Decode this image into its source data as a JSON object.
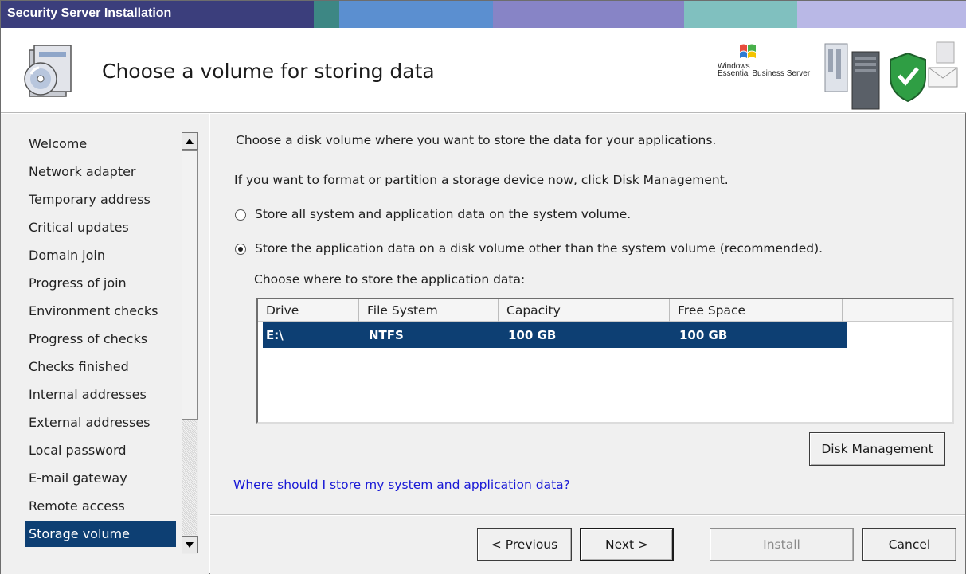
{
  "window": {
    "title": "Security Server Installation",
    "title_colors": [
      "#3a3d7a",
      "#4a5aa0",
      "#3e8a88",
      "#5a8fd0",
      "#8a86c7",
      "#7fbfbf",
      "#b9b9e6"
    ]
  },
  "header": {
    "title": "Choose a volume for storing data",
    "brand_line1": "Windows",
    "brand_line2": "Essential Business Server"
  },
  "sidebar": {
    "items": [
      {
        "label": "Welcome"
      },
      {
        "label": "Network adapter"
      },
      {
        "label": "Temporary address"
      },
      {
        "label": "Critical updates"
      },
      {
        "label": "Domain join"
      },
      {
        "label": "Progress of join"
      },
      {
        "label": "Environment checks"
      },
      {
        "label": "Progress of checks"
      },
      {
        "label": "Checks finished"
      },
      {
        "label": "Internal addresses"
      },
      {
        "label": "External addresses"
      },
      {
        "label": "Local password"
      },
      {
        "label": "E-mail gateway"
      },
      {
        "label": "Remote access"
      },
      {
        "label": "Storage volume"
      }
    ],
    "active_index": 14
  },
  "main": {
    "intro": "Choose a disk volume where you want to store the data for your applications.",
    "format_hint": "If you want to format or partition a storage device now, click Disk Management.",
    "option_system": "Store all system and application data on the system volume.",
    "option_other": "Store the application data on a disk volume other than the system volume (recommended).",
    "selected_option": "option_other",
    "choose_label": "Choose where to store the application data:",
    "table": {
      "columns": [
        "Drive",
        "File System",
        "Capacity",
        "Free Space"
      ],
      "rows": [
        {
          "drive": "E:\\",
          "file_system": "NTFS",
          "capacity": "100 GB",
          "free_space": "100 GB",
          "selected": true
        }
      ]
    },
    "disk_management_label": "Disk Management",
    "help_link": "Where should I store my system and application data?"
  },
  "footer": {
    "previous": "< Previous",
    "next": "Next >",
    "install": "Install",
    "cancel": "Cancel"
  }
}
